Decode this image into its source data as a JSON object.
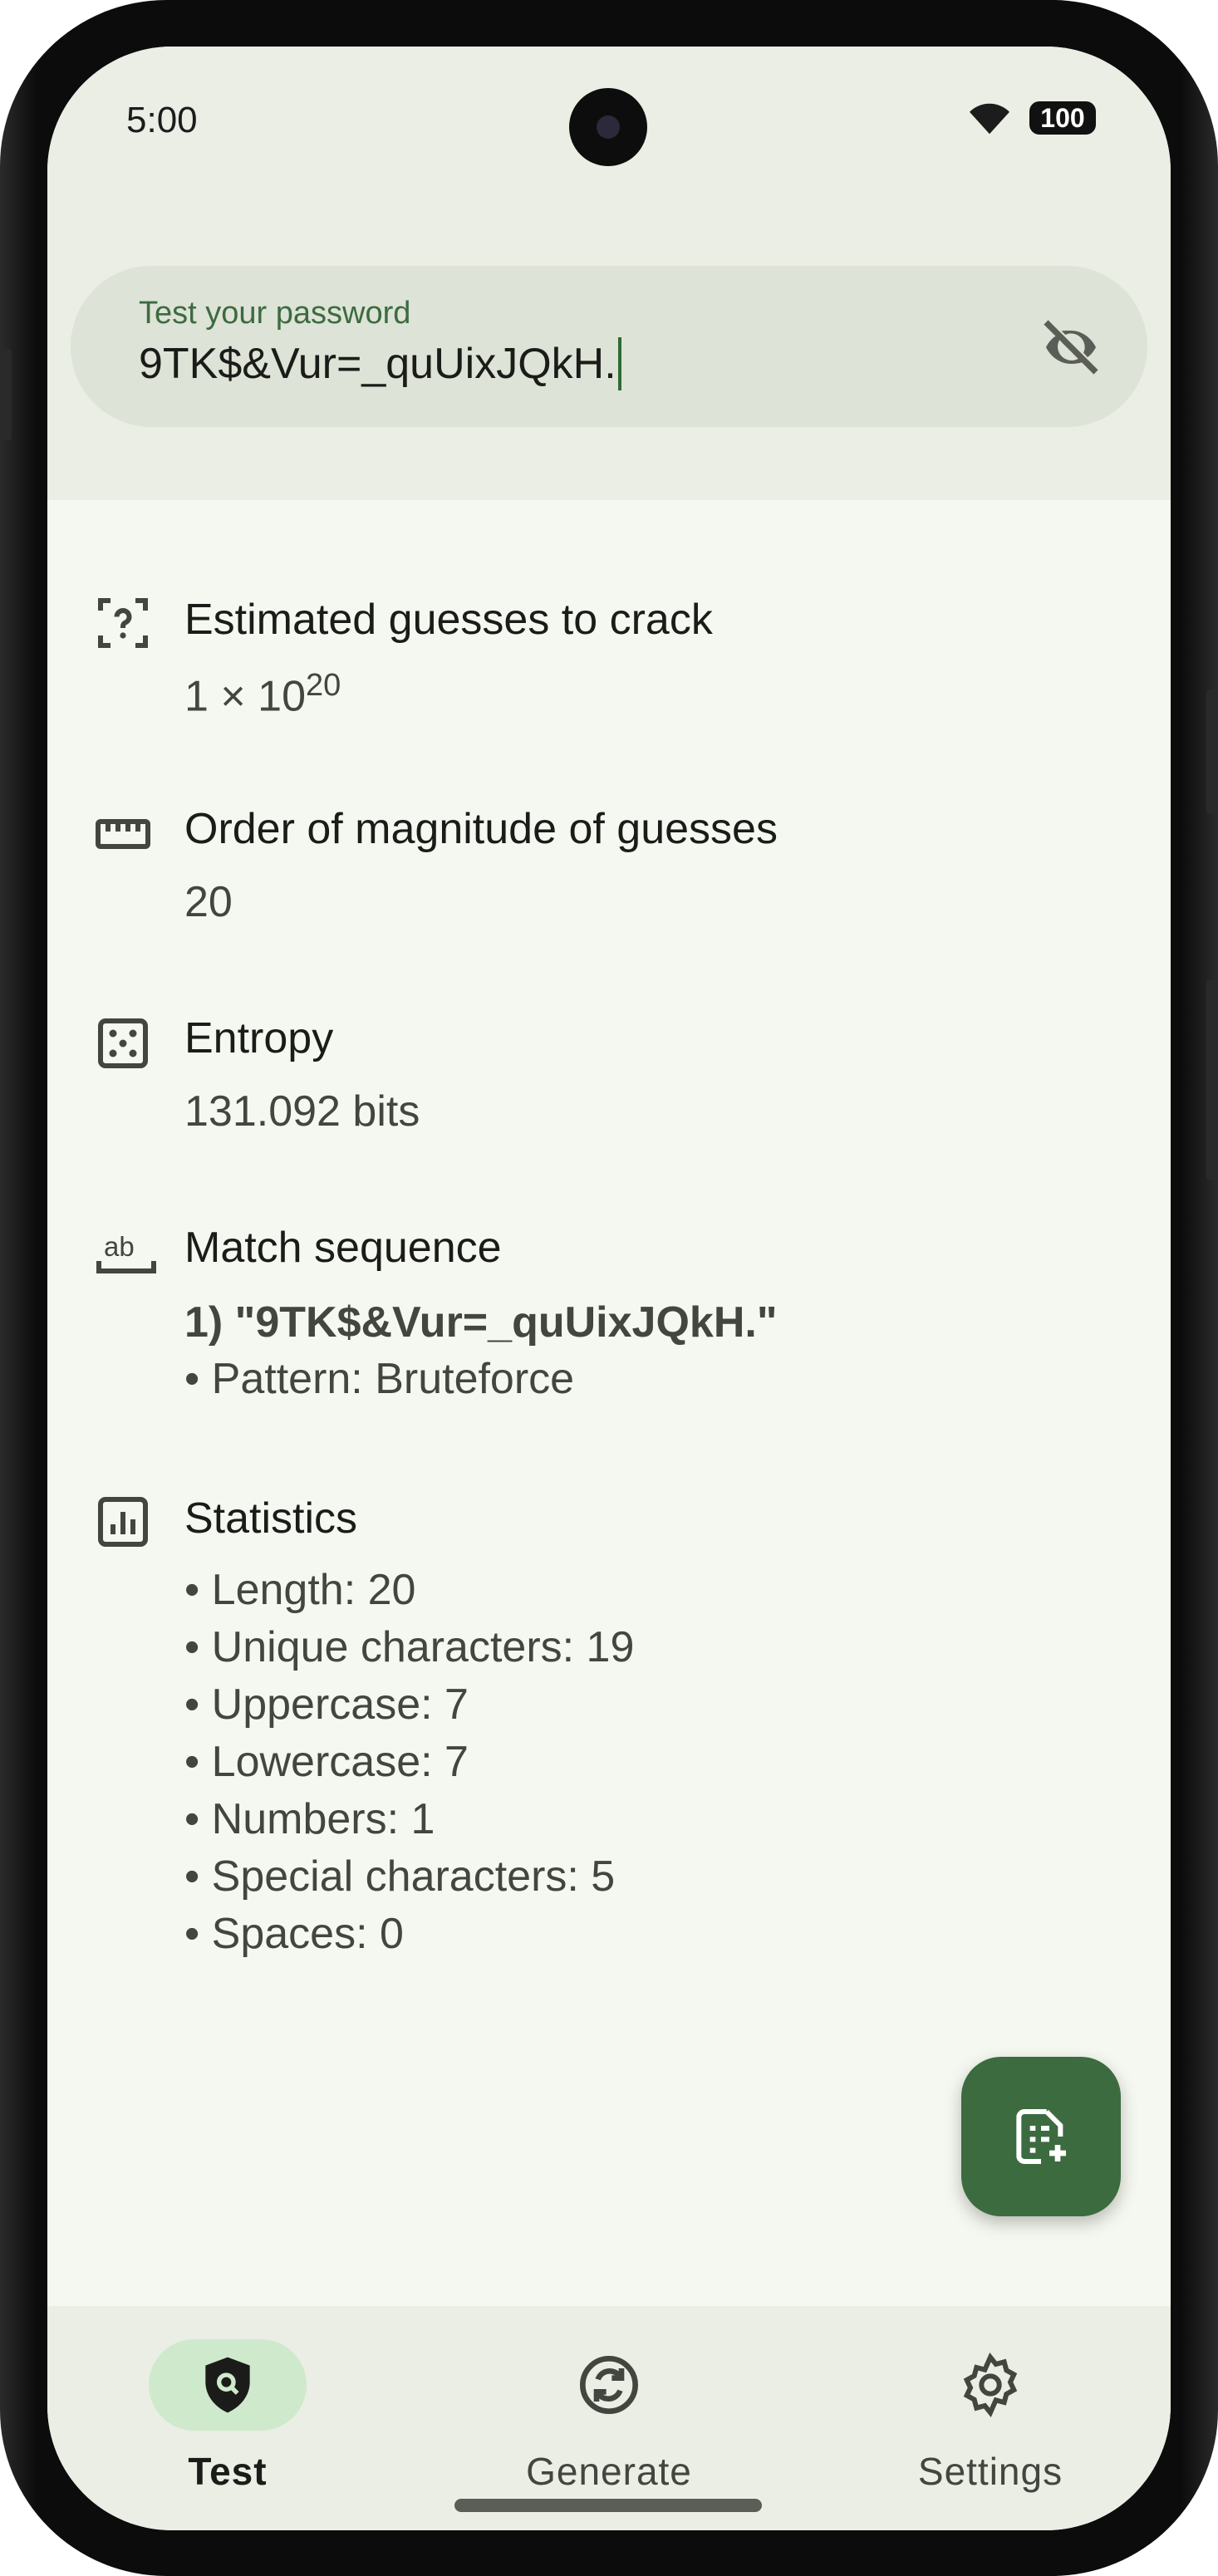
{
  "status_bar": {
    "time": "5:00",
    "battery": "100"
  },
  "search": {
    "label": "Test your password",
    "value": "9TK$&Vur=_quUixJQkH."
  },
  "sections": {
    "guesses": {
      "title": "Estimated guesses to crack",
      "value_base": "1 × 10",
      "value_exp": "20"
    },
    "magnitude": {
      "title": "Order of magnitude of guesses",
      "value": "20"
    },
    "entropy": {
      "title": "Entropy",
      "value": "131.092 bits"
    },
    "match": {
      "title": "Match sequence",
      "item": "1) \"9TK$&Vur=_quUixJQkH.\"",
      "pattern": "• Pattern: Bruteforce"
    },
    "statistics": {
      "title": "Statistics",
      "items": [
        "• Length: 20",
        "• Unique characters: 19",
        "• Uppercase: 7",
        "• Lowercase: 7",
        "• Numbers: 1",
        "• Special characters: 5",
        "• Spaces: 0"
      ]
    }
  },
  "nav": {
    "items": [
      {
        "label": "Test"
      },
      {
        "label": "Generate"
      },
      {
        "label": "Settings"
      }
    ]
  },
  "icons": {
    "guess": "help-box-dashed-icon",
    "magnitude": "ruler-icon",
    "entropy": "dice-icon",
    "match": "text-ab-icon",
    "stats": "chart-box-icon",
    "eye": "eye-off-icon",
    "fab": "add-list-icon"
  },
  "colors": {
    "accent": "#3c6b3f",
    "nav_active_pill": "#cfe9cc"
  }
}
